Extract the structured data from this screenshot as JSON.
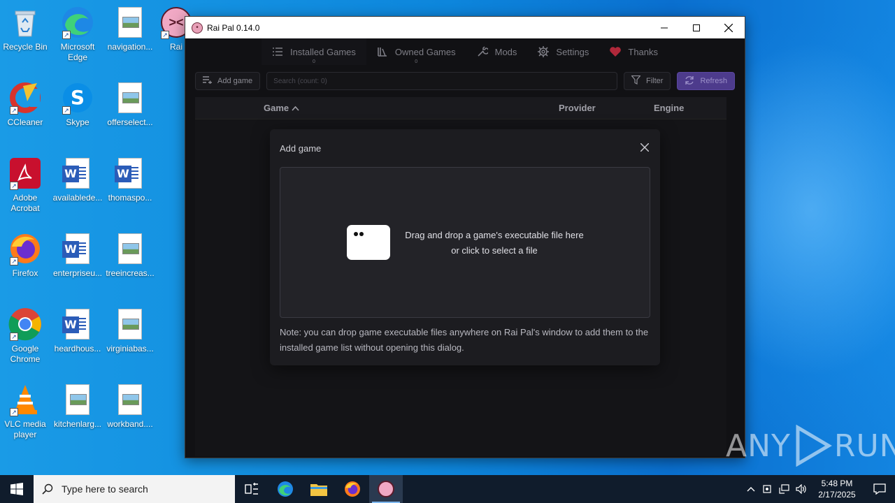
{
  "desktop": {
    "icons": [
      {
        "label": "Recycle Bin",
        "icon": "recycle-bin-icon"
      },
      {
        "label": "Microsoft Edge",
        "icon": "edge-icon"
      },
      {
        "label": "navigation...",
        "icon": "image-file-icon"
      },
      {
        "label": "Rai",
        "icon": "rai-pal-icon"
      },
      {
        "label": "CCleaner",
        "icon": "ccleaner-icon"
      },
      {
        "label": "Skype",
        "icon": "skype-icon"
      },
      {
        "label": "offerselect...",
        "icon": "image-file-icon"
      },
      {
        "label": "Adobe Acrobat",
        "icon": "acrobat-icon"
      },
      {
        "label": "availablede...",
        "icon": "word-doc-icon"
      },
      {
        "label": "thomaspo...",
        "icon": "word-doc-icon"
      },
      {
        "label": "Firefox",
        "icon": "firefox-icon"
      },
      {
        "label": "enterpriseu...",
        "icon": "word-doc-icon"
      },
      {
        "label": "treeincreas...",
        "icon": "image-file-icon"
      },
      {
        "label": "Google Chrome",
        "icon": "chrome-icon"
      },
      {
        "label": "heardhous...",
        "icon": "word-doc-icon"
      },
      {
        "label": "virginiabas...",
        "icon": "image-file-icon"
      },
      {
        "label": "VLC media player",
        "icon": "vlc-icon"
      },
      {
        "label": "kitchenlarg...",
        "icon": "image-file-icon"
      },
      {
        "label": "workband....",
        "icon": "image-file-icon"
      }
    ]
  },
  "window": {
    "title": "Rai Pal 0.14.0",
    "controls": {
      "minimize": "—",
      "maximize": "☐",
      "close": "✕"
    }
  },
  "nav": {
    "tabs": [
      {
        "label": "Installed Games",
        "count": "0",
        "icon": "list-icon"
      },
      {
        "label": "Owned Games",
        "count": "0",
        "icon": "library-icon"
      },
      {
        "label": "Mods",
        "count": "",
        "icon": "wrench-icon"
      },
      {
        "label": "Settings",
        "count": "",
        "icon": "gear-icon"
      },
      {
        "label": "Thanks",
        "count": "",
        "icon": "heart-icon"
      }
    ]
  },
  "toolbar": {
    "add_game_label": "Add game",
    "search_placeholder": "Search (count: 0)",
    "filter_label": "Filter",
    "refresh_label": "Refresh"
  },
  "table": {
    "columns": {
      "game": "Game",
      "provider": "Provider",
      "engine": "Engine"
    }
  },
  "dialog": {
    "title": "Add game",
    "drop_line1": "Drag and drop a game's executable file here",
    "drop_line2": "or click to select a file",
    "note": "Note: you can drop game executable files anywhere on Rai Pal's window to add them to the installed game list without opening this dialog."
  },
  "watermark": {
    "text_left": "ANY",
    "text_right": "RUN"
  },
  "taskbar": {
    "search_placeholder": "Type here to search",
    "time": "5:48 PM",
    "date": "2/17/2025"
  },
  "colors": {
    "accent_purple": "#4d3b8c",
    "heart_red": "#b0283a",
    "app_bg": "#111114"
  }
}
